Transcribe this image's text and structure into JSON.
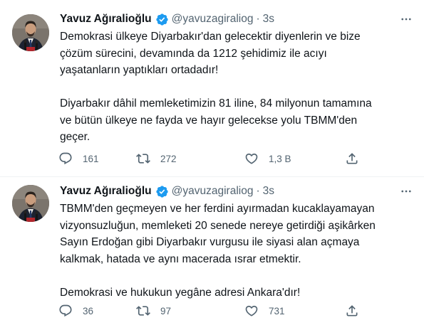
{
  "tweets": [
    {
      "author_name": "Yavuz Ağıralioğlu",
      "handle": "@yavuzagiraliog",
      "separator": "·",
      "time": "3s",
      "lines": [
        "Demokrasi ülkeye Diyarbakır'dan gelecektir diyenlerin ve bize",
        "çözüm sürecini, devamında da 1212 şehidimiz ile acıyı",
        "yaşatanların yaptıkları ortadadır!",
        "",
        "Diyarbakır dâhil memleketimizin 81 iline, 84 milyonun tamamına",
        "ve bütün ülkeye ne fayda ve hayır gelecekse yolu TBMM'den",
        "geçer."
      ],
      "replies": "161",
      "retweets": "272",
      "likes": "1,3 B"
    },
    {
      "author_name": "Yavuz Ağıralioğlu",
      "handle": "@yavuzagiraliog",
      "separator": "·",
      "time": "3s",
      "lines": [
        "TBMM'den geçmeyen ve her ferdini ayırmadan kucaklayamayan",
        "vizyonsuzluğun, memleketi 20 senede nereye getirdiği aşikârken",
        "Sayın Erdoğan gibi Diyarbakır vurgusu ile siyasi alan açmaya",
        "kalkmak, hatada ve aynı macerada ısrar etmektir.",
        "",
        "Demokrasi ve hukukun yegâne adresi Ankara'dır!"
      ],
      "replies": "36",
      "retweets": "97",
      "likes": "731"
    }
  ],
  "colors": {
    "text": "#0f1419",
    "secondary": "#536471",
    "verified": "#1d9bf0",
    "divider": "#eff3f4"
  },
  "icons": [
    "verified-badge-icon",
    "more-options-icon",
    "reply-icon",
    "retweet-icon",
    "like-icon",
    "share-icon"
  ]
}
